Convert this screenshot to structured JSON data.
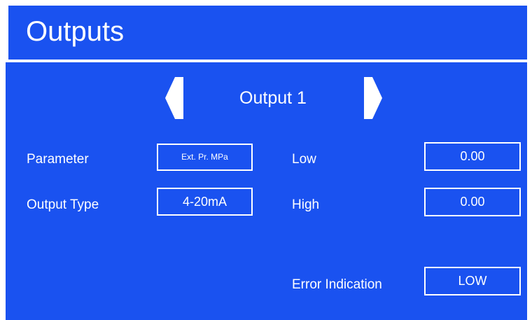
{
  "header": {
    "title": "Outputs"
  },
  "navigator": {
    "title": "Output 1",
    "prev_icon": "arrow-left-icon",
    "next_icon": "arrow-right-icon"
  },
  "fields": {
    "parameter": {
      "label": "Parameter",
      "value": "Ext. Pr. MPa"
    },
    "output_type": {
      "label": "Output Type",
      "value": "4-20mA"
    },
    "low": {
      "label": "Low",
      "value": "0.00"
    },
    "high": {
      "label": "High",
      "value": "0.00"
    },
    "error_indication": {
      "label": "Error Indication",
      "value": "LOW"
    }
  },
  "colors": {
    "background": "#1a52f0",
    "text": "#ffffff"
  }
}
